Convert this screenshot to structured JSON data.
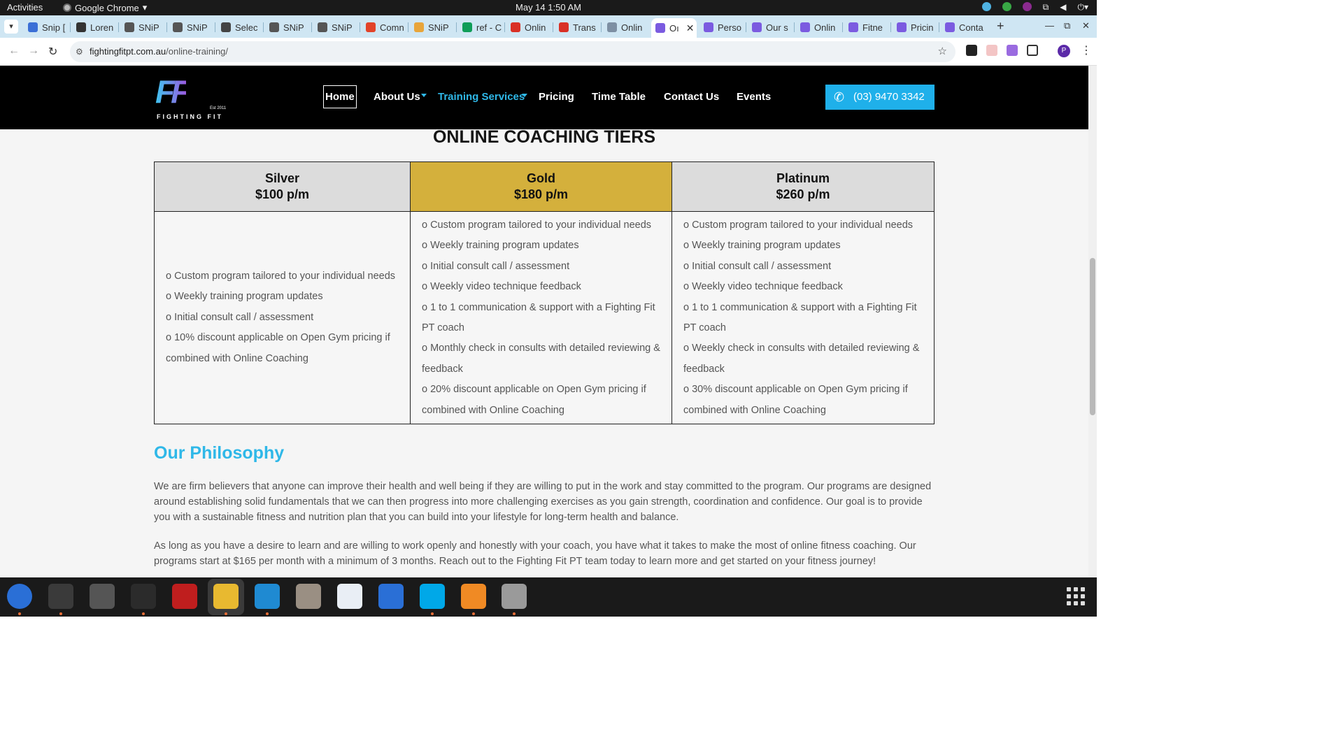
{
  "system": {
    "activities": "Activities",
    "app_name": "Google Chrome",
    "clock": "May 14  1:50 AM"
  },
  "tabs": [
    {
      "label": "Snip [",
      "color": "#3b6fd6"
    },
    {
      "label": "Loren",
      "color": "#333333"
    },
    {
      "label": "SNiP",
      "color": "#555555"
    },
    {
      "label": "SNiP",
      "color": "#555555"
    },
    {
      "label": "Selec",
      "color": "#444444"
    },
    {
      "label": "SNiP",
      "color": "#555555"
    },
    {
      "label": "SNiP",
      "color": "#555555"
    },
    {
      "label": "Comn",
      "color": "#e24329"
    },
    {
      "label": "SNiP",
      "color": "#e8a53a"
    },
    {
      "label": "ref - C",
      "color": "#0f9d58"
    },
    {
      "label": "Onlin",
      "color": "#d93025"
    },
    {
      "label": "Trans",
      "color": "#d93025"
    },
    {
      "label": "Onlin",
      "color": "#7d8fa3"
    },
    {
      "label": "Oı",
      "color": "#7b5be0",
      "active": true
    },
    {
      "label": "Perso",
      "color": "#7b5be0"
    },
    {
      "label": "Our s",
      "color": "#7b5be0"
    },
    {
      "label": "Onlin",
      "color": "#7b5be0"
    },
    {
      "label": "Fitne",
      "color": "#7b5be0"
    },
    {
      "label": "Pricin",
      "color": "#7b5be0"
    },
    {
      "label": "Conta",
      "color": "#7b5be0"
    }
  ],
  "address": {
    "host": "fightingfitpt.com.au",
    "path": "/online-training/"
  },
  "site": {
    "logo_est": "Est 2011",
    "logo_word": "FIGHTING FIT",
    "nav": {
      "home": "Home",
      "about": "About Us",
      "training": "Training Services",
      "pricing": "Pricing",
      "timetable": "Time Table",
      "contact": "Contact Us",
      "events": "Events"
    },
    "phone": "(03) 9470 3342",
    "brand_blue": "#2fb8e8"
  },
  "tiers": {
    "title": "ONLINE COACHING TIERS",
    "columns": [
      {
        "name": "Silver",
        "price": "$100 p/m",
        "header_color": "#dcdcdc",
        "features": [
          "Custom program tailored to your individual needs",
          "Weekly training program updates",
          "Initial consult call / assessment",
          "10% discount applicable on Open Gym pricing if combined with Online Coaching"
        ]
      },
      {
        "name": "Gold",
        "price": "$180 p/m",
        "header_color": "#d4b03c",
        "features": [
          "Custom program tailored to your individual needs",
          "Weekly training program updates",
          "Initial consult call / assessment",
          "Weekly video technique feedback",
          "1 to 1 communication & support with a Fighting Fit PT coach",
          "Monthly check in consults with detailed reviewing & feedback",
          "20% discount applicable on Open Gym pricing if combined with Online Coaching"
        ]
      },
      {
        "name": "Platinum",
        "price": "$260 p/m",
        "header_color": "#dcdcdc",
        "features": [
          "Custom program tailored to your individual needs",
          "Weekly training program updates",
          "Initial consult call / assessment",
          "Weekly video technique feedback",
          "1 to 1 communication & support with a Fighting Fit PT coach",
          "Weekly check in consults with detailed reviewing & feedback",
          "30% discount applicable on Open Gym pricing if combined with Online Coaching"
        ]
      }
    ],
    "bullet": "o"
  },
  "philosophy": {
    "title": "Our Philosophy",
    "p1": "We are firm believers that anyone can improve their health and well being if they are willing to put in the work and stay committed to the program. Our programs are designed around establishing solid fundamentals that we can then progress into more challenging exercises as you gain strength, coordination and confidence. Our goal is to provide you with a sustainable fitness and nutrition plan that you can build into your lifestyle for long-term health and balance.",
    "p2": "As long as you have a desire to learn and are willing to work openly and honestly with your coach, you have what it takes to make the most of online fitness coaching. Our programs start at $165 per month with a minimum of 3 months. Reach out to the Fighting Fit PT team today to learn more and get started on your fitness journey!"
  },
  "dock": [
    {
      "name": "thunderbird-icon",
      "color": "#2a6fd6"
    },
    {
      "name": "terminal-icon",
      "color": "#3a3a3a"
    },
    {
      "name": "calculator-icon",
      "color": "#555555"
    },
    {
      "name": "system-monitor-icon",
      "color": "#2b2b2b"
    },
    {
      "name": "filezilla-icon",
      "color": "#bf1e1e"
    },
    {
      "name": "chrome-icon",
      "color": "#e8b930"
    },
    {
      "name": "vscode-icon",
      "color": "#1f8ad2"
    },
    {
      "name": "files-icon",
      "color": "#9a8f83"
    },
    {
      "name": "text-editor-icon",
      "color": "#e9eef5"
    },
    {
      "name": "libreoffice-writer-icon",
      "color": "#2a6fd6"
    },
    {
      "name": "skype-icon",
      "color": "#00a8e8"
    },
    {
      "name": "firefox-dev-icon",
      "color": "#f08a24"
    },
    {
      "name": "disk-utility-icon",
      "color": "#9a9a9a"
    }
  ]
}
